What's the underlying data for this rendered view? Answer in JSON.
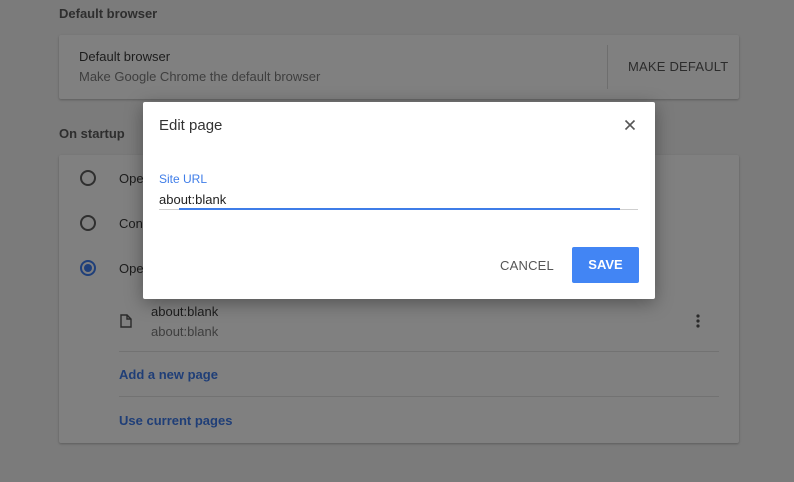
{
  "default_browser": {
    "section_title": "Default browser",
    "row_title": "Default browser",
    "row_desc": "Make Google Chrome the default browser",
    "button_label": "MAKE DEFAULT"
  },
  "on_startup": {
    "section_title": "On startup",
    "options": [
      {
        "label": "Ope",
        "selected": false
      },
      {
        "label": "Cont",
        "selected": false
      },
      {
        "label": "Ope",
        "selected": true
      }
    ],
    "pages": [
      {
        "name": "about:blank",
        "url": "about:blank",
        "icon": "page-icon",
        "menu_icon": "more-vert-icon"
      }
    ],
    "add_page_label": "Add a new page",
    "use_current_label": "Use current pages"
  },
  "dialog": {
    "title": "Edit page",
    "close_icon": "close-icon",
    "field_label": "Site URL",
    "field_value": "about:blank",
    "cancel_label": "CANCEL",
    "save_label": "SAVE"
  },
  "colors": {
    "accent": "#4285f4",
    "focus": "#3f7de8",
    "scrim_background": "#7b7b7b"
  }
}
